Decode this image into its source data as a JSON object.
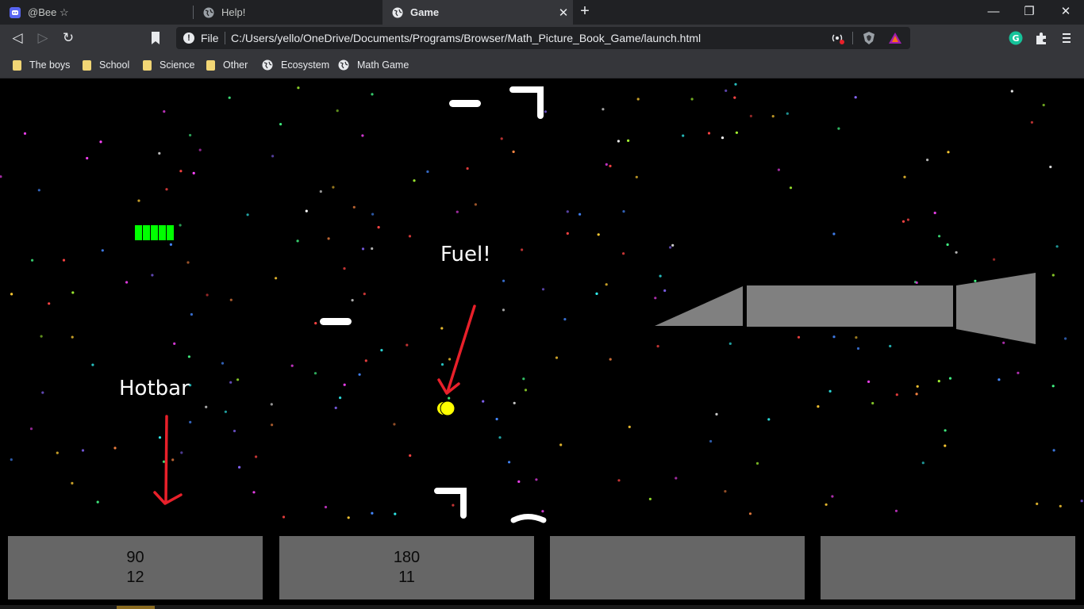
{
  "tabs": [
    {
      "title": "@Bee ☆",
      "icon": "discord-icon",
      "active": false
    },
    {
      "title": "Help!",
      "icon": "globe-icon",
      "active": false
    },
    {
      "title": "Game",
      "icon": "globe-icon",
      "active": true
    }
  ],
  "toolbar": {
    "scheme": "File",
    "url": "C:/Users/yello/OneDrive/Documents/Programs/Browser/Math_Picture_Book_Game/launch.html"
  },
  "bookmarks": [
    {
      "label": "The boys",
      "icon": "folder-icon"
    },
    {
      "label": "School",
      "icon": "folder-icon"
    },
    {
      "label": "Science",
      "icon": "folder-icon"
    },
    {
      "label": "Other",
      "icon": "folder-icon"
    },
    {
      "label": "Ecosystem",
      "icon": "globe-icon"
    },
    {
      "label": "Math Game",
      "icon": "globe-icon"
    }
  ],
  "game": {
    "fuel_label": "Fuel!",
    "hotbar_label": "Hotbar",
    "fuel_segments": 5,
    "colors": {
      "background": "#000000",
      "fuel_gauge": "#00ff00",
      "fuel_pickup": "#ffff00",
      "ship": "#808080",
      "annotation_arrow": "#e8202a",
      "hotbar_slot": "#666666"
    },
    "hotbar": [
      {
        "line1": "90",
        "line2": "12"
      },
      {
        "line1": "180",
        "line2": "11"
      },
      {
        "line1": "",
        "line2": ""
      },
      {
        "line1": "",
        "line2": ""
      }
    ]
  }
}
